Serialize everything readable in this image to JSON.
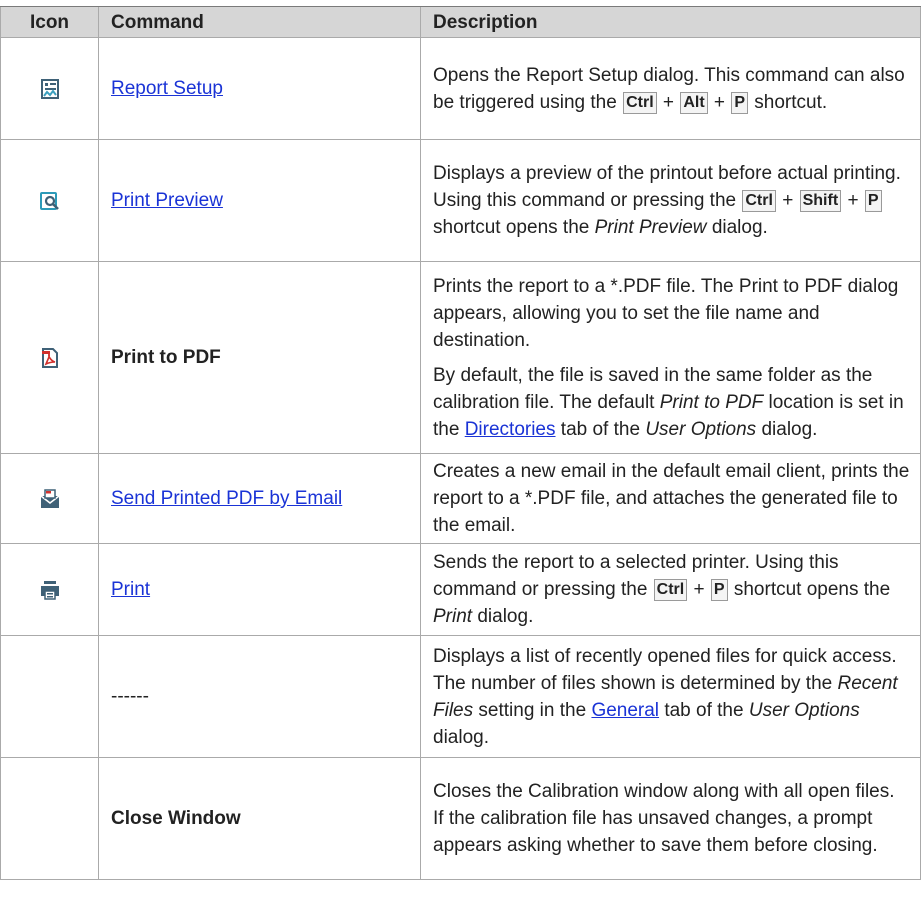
{
  "headers": {
    "icon": "Icon",
    "command": "Command",
    "description": "Description"
  },
  "rows": [
    {
      "command": "Report Setup",
      "icon": "report-setup-icon",
      "desc": {
        "a": "Opens the Report Setup dialog. This command can also be triggered using the",
        "k1": "Ctrl",
        "plus1": "+",
        "k2": "Alt",
        "plus2": "+",
        "k3": "P",
        "b": "shortcut."
      }
    },
    {
      "command": "Print Preview",
      "icon": "print-preview-icon",
      "desc": {
        "a": "Displays a preview of the printout before actual printing. Using this command or pressing the",
        "k1": "Ctrl",
        "plus1": "+",
        "k2": "Shift",
        "plus2": "+",
        "k3": "P",
        "b": "shortcut opens the",
        "i": "Print Preview",
        "c": "dialog."
      }
    },
    {
      "command": "Print to PDF",
      "icon": "pdf-icon",
      "desc": {
        "p1": "Prints the report to a *.PDF file. The Print to PDF dialog appears, allowing you to set the file name and destination.",
        "a": "By default, the file is saved in the same folder as the calibration file. The default",
        "i1": "Print to PDF",
        "b": "location is set in the",
        "link": "Directories",
        "c": "tab of the",
        "i2": "User Options",
        "d": "dialog."
      }
    },
    {
      "command": "Send Printed PDF by Email",
      "icon": "email-pdf-icon",
      "desc": {
        "a": "Creates a new email in the default email client, prints the report to a *.PDF file, and attaches the generated file to the email."
      }
    },
    {
      "command": "Print",
      "icon": "printer-icon",
      "desc": {
        "a": "Sends the report to a selected printer. Using this command or pressing the",
        "k1": "Ctrl",
        "plus1": "+",
        "k2": "P",
        "b": "shortcut opens the",
        "i": "Print",
        "c": "dialog."
      }
    },
    {
      "command": "------",
      "desc": {
        "a": "Displays a list of recently opened files for quick access. The number of files shown is determined by the",
        "i1": "Recent Files",
        "b": "setting in the",
        "link": "General",
        "c": "tab of the",
        "i2": "User Options",
        "d": "dialog."
      }
    },
    {
      "command": "Close Window",
      "desc": {
        "a": "Closes the Calibration window along with all open files. If the calibration file has unsaved changes, a prompt appears asking whether to save them before closing."
      }
    }
  ]
}
